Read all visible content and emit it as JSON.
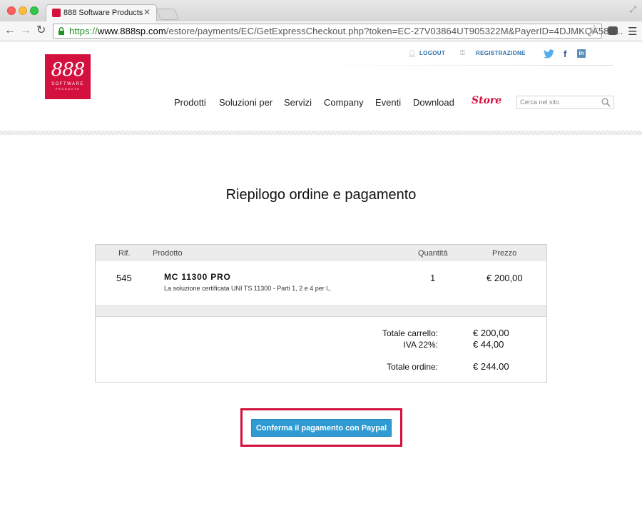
{
  "browser": {
    "tab_title": "888 Software Products",
    "url_scheme": "https://",
    "url_host": "www.888sp.com",
    "url_path": "/estore/payments/EC/GetExpressCheckout.php?token=EC-27V03864UT905322M&PayerID=4DJMKQA58X..."
  },
  "logo": {
    "number": "888",
    "line1": "SOFTWARE",
    "line2": "PRODUCTS"
  },
  "utility_links": {
    "logout": "LOGOUT",
    "register": "REGISTRAZIONE"
  },
  "social": {
    "facebook": "f",
    "linkedin": "in"
  },
  "nav": {
    "items": [
      "Prodotti",
      "Soluzioni per",
      "Servizi",
      "Company",
      "Eventi",
      "Download"
    ],
    "store": "Store"
  },
  "search": {
    "placeholder": "Cerca nel sito"
  },
  "page": {
    "title": "Riepilogo ordine e pagamento"
  },
  "order": {
    "headers": {
      "ref": "Rif.",
      "product": "Prodotto",
      "qty": "Quantità",
      "price": "Prezzo"
    },
    "item": {
      "ref": "545",
      "name": "MC 11300 PRO",
      "description": "La soluzione certificata UNI TS 11300 - Parti 1, 2 e 4 per l..",
      "qty": "1",
      "price": "€ 200,00"
    },
    "totals": {
      "cart_label": "Totale carrello:",
      "cart_value": "€ 200,00",
      "vat_label": "IVA 22%:",
      "vat_value": "€ 44,00",
      "order_label": "Totale ordine:",
      "order_value": "€ 244.00"
    }
  },
  "confirm_button": "Conferma il pagamento con Paypal",
  "colors": {
    "brand": "#d4103e",
    "button": "#2f9bd2",
    "link": "#2a6fa8"
  }
}
